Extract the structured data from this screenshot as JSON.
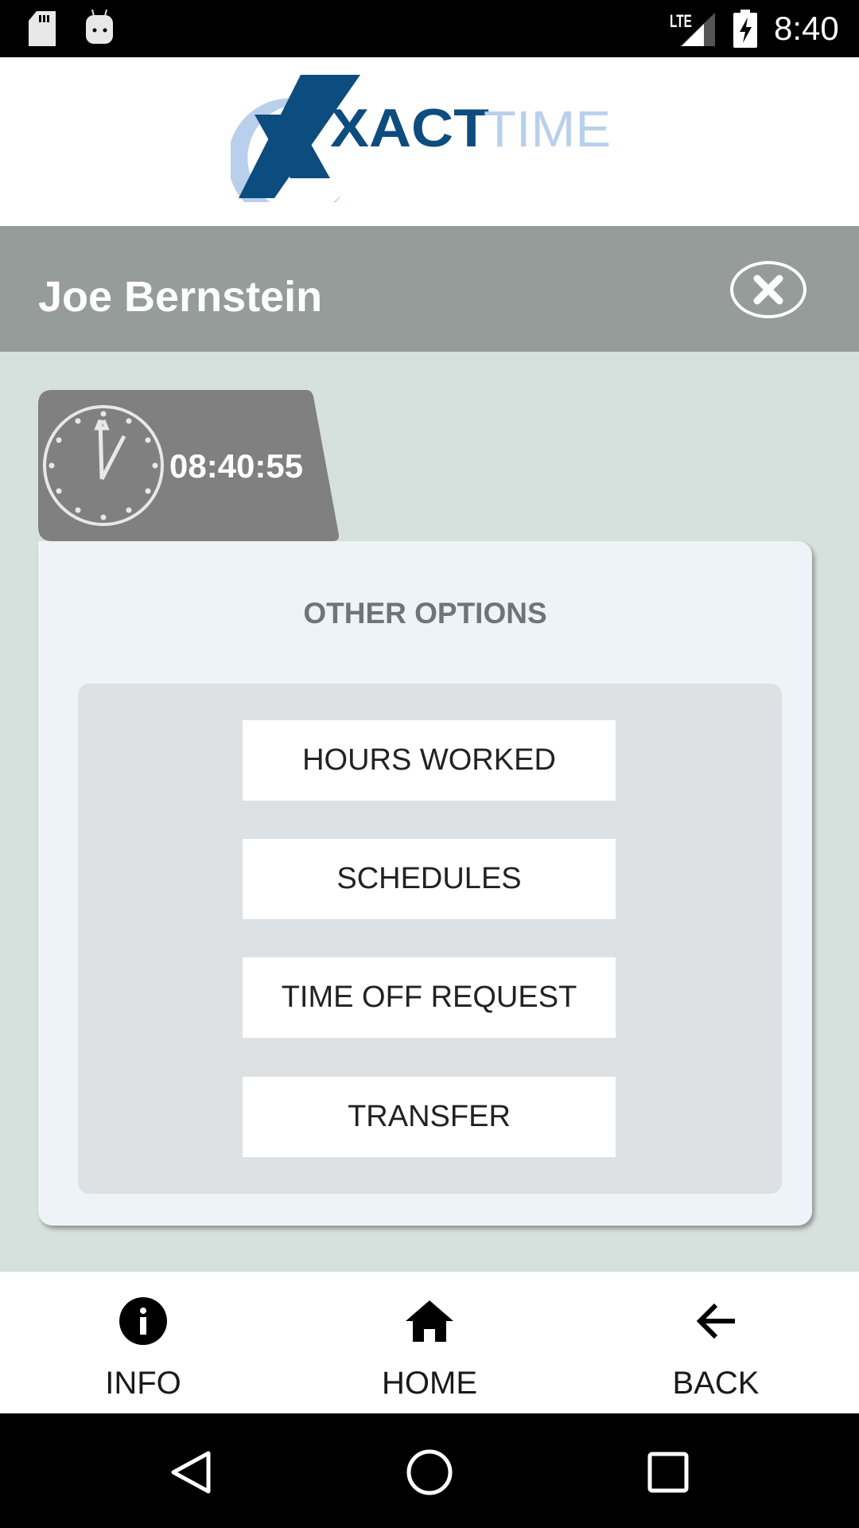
{
  "status_bar": {
    "time": "8:40",
    "network": "LTE",
    "icons": [
      "sd-card-icon",
      "android-debug-icon",
      "signal-icon",
      "battery-charging-icon"
    ]
  },
  "logo": {
    "text_main": "XACT",
    "text_secondary": "TIME",
    "colors": {
      "dark": "#0d4c7e",
      "light": "#b9d0ec"
    }
  },
  "header": {
    "user_name": "Joe Bernstein",
    "close_icon": "close-circle-icon"
  },
  "clock": {
    "time": "08:40:55",
    "icon": "clock-icon"
  },
  "card": {
    "title": "OTHER OPTIONS",
    "options": [
      {
        "label": "HOURS WORKED"
      },
      {
        "label": "SCHEDULES"
      },
      {
        "label": "TIME OFF REQUEST"
      },
      {
        "label": "TRANSFER"
      }
    ]
  },
  "bottom_nav": [
    {
      "label": "INFO",
      "icon": "info-icon"
    },
    {
      "label": "HOME",
      "icon": "home-icon"
    },
    {
      "label": "BACK",
      "icon": "arrow-back-icon"
    }
  ],
  "system_nav": {
    "icons": [
      "back-triangle-icon",
      "home-circle-icon",
      "recents-square-icon"
    ]
  },
  "colors": {
    "header": "#969c99",
    "background": "#d6e1dd",
    "card": "#eef3f8",
    "panel": "#dde1e3",
    "clock_tab": "#808080"
  }
}
